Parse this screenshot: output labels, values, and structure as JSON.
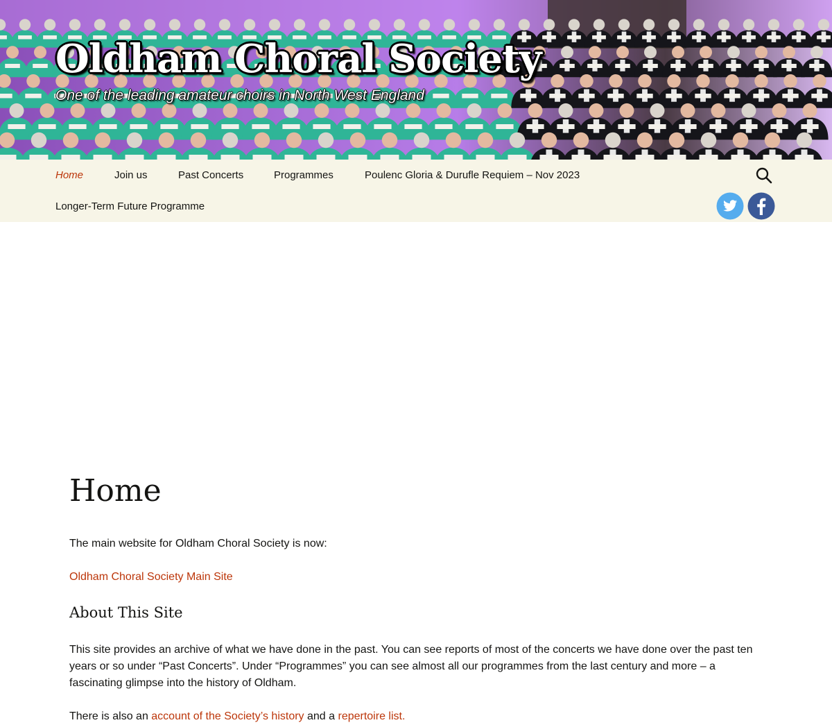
{
  "header": {
    "site_title": "Oldham Choral Society",
    "site_description": "One of the leading amateur choirs in North West England"
  },
  "nav": {
    "items": [
      {
        "label": "Home",
        "current": true
      },
      {
        "label": "Join us"
      },
      {
        "label": "Past Concerts"
      },
      {
        "label": "Programmes"
      },
      {
        "label": "Poulenc Gloria & Durufle Requiem – Nov 2023"
      },
      {
        "label": "Longer-Term Future Programme"
      }
    ],
    "search_icon": "search-icon",
    "social": [
      {
        "name": "twitter",
        "icon": "twitter-icon",
        "color": "#55acee"
      },
      {
        "name": "facebook",
        "icon": "facebook-icon",
        "color": "#3b5998"
      }
    ]
  },
  "content": {
    "page_title": "Home",
    "intro": "The main website for Oldham Choral Society is now:",
    "main_site_link": "Oldham Choral Society Main Site",
    "section_heading": "About This Site",
    "about_text": "This site provides an archive of what we have done in the past.  You can see reports of most of the concerts we have done over the past ten years or so under “Past Concerts”.  Under “Programmes” you can see almost all our programmes from the last century and more – a fascinating glimpse into the history of Oldham.",
    "history_prefix": "There is also an ",
    "history_link": "account of the Society’s history",
    "history_middle": " and a ",
    "repertoire_link": "repertoire list."
  },
  "colors": {
    "accent": "#bc360a",
    "nav_background": "#f7f5e7",
    "robe_green": "#2fb597",
    "stage_purple": "#b873e8"
  }
}
